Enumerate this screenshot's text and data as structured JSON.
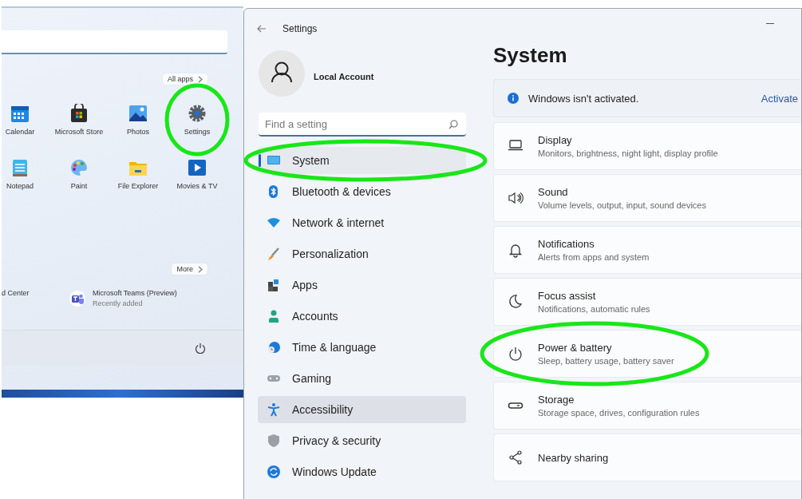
{
  "start_menu": {
    "all_apps_button": {
      "label": "All apps"
    },
    "pinned_apps": [
      {
        "label": "Calendar",
        "highlighted": false
      },
      {
        "label": "Microsoft Store",
        "highlighted": false
      },
      {
        "label": "Photos",
        "highlighted": false
      },
      {
        "label": "Settings",
        "highlighted": true
      },
      {
        "label": "Notepad",
        "highlighted": false
      },
      {
        "label": "Paint",
        "highlighted": false
      },
      {
        "label": "File Explorer",
        "highlighted": false
      },
      {
        "label": "Movies & TV",
        "highlighted": false
      }
    ],
    "more_button": {
      "label": "More"
    },
    "recommended": [
      {
        "title": "d Center"
      },
      {
        "title": "Microsoft Teams (Preview)",
        "subtitle": "Recently added"
      }
    ]
  },
  "settings_window": {
    "title": "Settings",
    "account": {
      "name": "Local Account"
    },
    "search": {
      "placeholder": "Find a setting"
    },
    "nav_items": [
      {
        "label": "System",
        "selected": true,
        "hovered": false,
        "highlighted": true
      },
      {
        "label": "Bluetooth & devices",
        "selected": false,
        "hovered": false,
        "highlighted": false
      },
      {
        "label": "Network & internet",
        "selected": false,
        "hovered": false,
        "highlighted": false
      },
      {
        "label": "Personalization",
        "selected": false,
        "hovered": false,
        "highlighted": false
      },
      {
        "label": "Apps",
        "selected": false,
        "hovered": false,
        "highlighted": false
      },
      {
        "label": "Accounts",
        "selected": false,
        "hovered": false,
        "highlighted": false
      },
      {
        "label": "Time & language",
        "selected": false,
        "hovered": false,
        "highlighted": false
      },
      {
        "label": "Gaming",
        "selected": false,
        "hovered": false,
        "highlighted": false
      },
      {
        "label": "Accessibility",
        "selected": false,
        "hovered": true,
        "highlighted": false
      },
      {
        "label": "Privacy & security",
        "selected": false,
        "hovered": false,
        "highlighted": false
      },
      {
        "label": "Windows Update",
        "selected": false,
        "hovered": false,
        "highlighted": false
      }
    ],
    "page_title": "System",
    "activation_banner": {
      "message": "Windows isn't activated.",
      "link": "Activate"
    },
    "cards": [
      {
        "title": "Display",
        "subtitle": "Monitors, brightness, night light, display profile",
        "highlighted": false
      },
      {
        "title": "Sound",
        "subtitle": "Volume levels, output, input, sound devices",
        "highlighted": false
      },
      {
        "title": "Notifications",
        "subtitle": "Alerts from apps and system",
        "highlighted": false
      },
      {
        "title": "Focus assist",
        "subtitle": "Notifications, automatic rules",
        "highlighted": false
      },
      {
        "title": "Power & battery",
        "subtitle": "Sleep, battery usage, battery saver",
        "highlighted": true
      },
      {
        "title": "Storage",
        "subtitle": "Storage space, drives, configuration rules",
        "highlighted": false
      },
      {
        "title": "Nearby sharing",
        "highlighted": false
      }
    ]
  }
}
